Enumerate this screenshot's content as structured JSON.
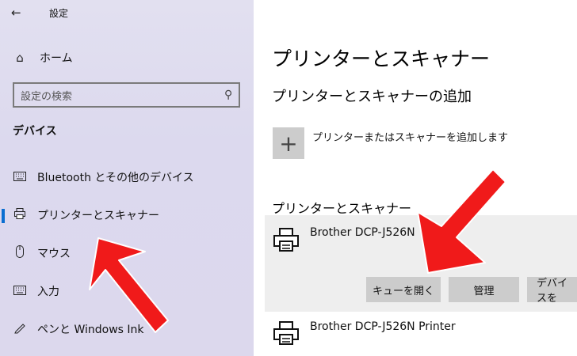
{
  "window": {
    "title": "設定"
  },
  "sidebar": {
    "home_label": "ホーム",
    "search_placeholder": "設定の検索",
    "section_heading": "デバイス",
    "items": [
      {
        "label": "Bluetooth とその他のデバイス",
        "icon": "keyboard-icon",
        "selected": false
      },
      {
        "label": "プリンターとスキャナー",
        "icon": "printer-icon",
        "selected": true
      },
      {
        "label": "マウス",
        "icon": "mouse-icon",
        "selected": false
      },
      {
        "label": "入力",
        "icon": "keyboard-icon",
        "selected": false
      },
      {
        "label": "ペンと Windows Ink",
        "icon": "pen-icon",
        "selected": false
      }
    ]
  },
  "main": {
    "title": "プリンターとスキャナー",
    "add_section_heading": "プリンターとスキャナーの追加",
    "add_button_label": "プリンターまたはスキャナーを追加します",
    "list_heading": "プリンターとスキャナー",
    "devices": [
      {
        "name": "Brother DCP-J526N",
        "expanded": true
      },
      {
        "name": "Brother DCP-J526N Printer",
        "expanded": false
      }
    ],
    "device_buttons": [
      "キューを開く",
      "管理",
      "デバイスを"
    ]
  },
  "annotations": {
    "arrow_color": "#f01a1a"
  }
}
